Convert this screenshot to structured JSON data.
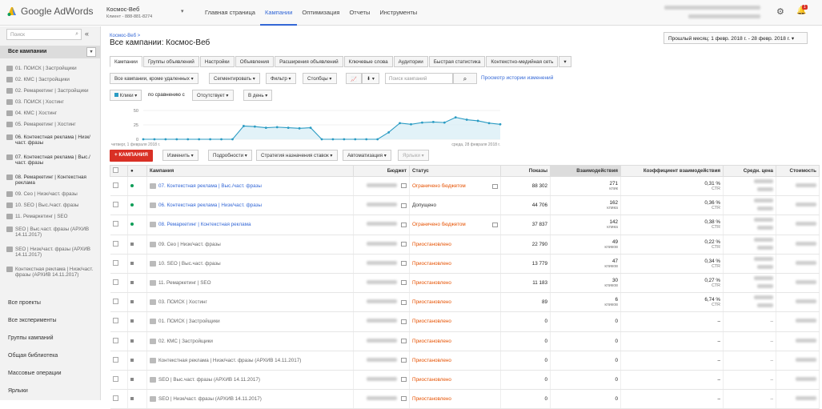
{
  "header": {
    "logo_text": "Google AdWords",
    "account_name": "Космос-Веб",
    "account_sub": "Клиент - 888-881-8274",
    "nav": [
      "Главная страница",
      "Кампании",
      "Оптимизация",
      "Отчеты",
      "Инструменты"
    ],
    "active_nav": "Кампании",
    "bell_count": "1"
  },
  "sidebar": {
    "search_placeholder": "Поиск",
    "all_campaigns": "Все кампании",
    "items": [
      "01. ПОИСК | Застройщики",
      "02. КМС | Застройщики",
      "02. Ремаркетинг | Застройщики",
      "03. ПОИСК | Хостинг",
      "04. КМС | Хостинг",
      "05. Ремаркетинг | Хостинг",
      "06. Контекстная реклама | Низк/част. фразы",
      "07. Контекстная реклама | Выс./част. фразы",
      "08. Ремаркетинг | Контекстная реклама",
      "09. Сео | Низк/част. фразы",
      "10. SEO | Выс./част. фразы",
      "11. Ремаркетинг | SEO",
      "SEO | Выс.част. фразы (АРХИВ 14.11.2017)",
      "SEO | Низк/част. фразы (АРХИВ 14.11.2017)",
      "Контекстная реклама | Низк/част. фразы (АРХИВ 14.11.2017)"
    ],
    "bottom": [
      "Все проекты",
      "Все эксперименты",
      "Группы кампаний",
      "Общая библиотека",
      "Массовые операции",
      "Ярлыки"
    ]
  },
  "page": {
    "breadcrumb": "Космос-Веб >",
    "title": "Все кампании: Космос-Веб",
    "date_range": "Прошлый месяц: 1 февр. 2018 г. - 28 февр. 2018 г."
  },
  "tabs": [
    "Кампании",
    "Группы объявлений",
    "Настройки",
    "Объявления",
    "Расширения объявлений",
    "Ключевые слова",
    "Аудитории",
    "Быстрая статистика",
    "Контекстно-медийная сеть",
    "▾"
  ],
  "toolbar": {
    "filter_all": "Все кампании, кроме удаленных",
    "segment": "Сегментировать",
    "filter": "Фильтр",
    "columns": "Столбцы",
    "search_placeholder": "Поиск кампаний",
    "history_link": "Просмотр истории изменений",
    "metric": "Клики",
    "compare_label": "по сравнению с",
    "compare_value": "Отсутствует",
    "period": "В день",
    "add_campaign": "+ КАМПАНИЯ",
    "edit": "Изменить",
    "details": "Подробности",
    "bid_strategy": "Стратегия назначения ставок",
    "automation": "Автоматизация",
    "labels": "Ярлыки"
  },
  "chart_data": {
    "type": "line",
    "ylim": [
      0,
      50
    ],
    "yticks": [
      0,
      25,
      50
    ],
    "x_start_label": "четверг, 1 февраля 2018 г.",
    "x_end_label": "среда, 28 февраля 2018 г.",
    "values": [
      0,
      0,
      0,
      0,
      0,
      0,
      0,
      0,
      0,
      23,
      22,
      20,
      21,
      20,
      19,
      20,
      0,
      0,
      0,
      0,
      0,
      0,
      12,
      28,
      26,
      29,
      30,
      29,
      38,
      34,
      32,
      28,
      26
    ]
  },
  "table": {
    "headers": [
      "",
      "●",
      "Кампания",
      "Бюджет",
      "Статус",
      "Показы",
      "Взаимодействия",
      "Коэффициент взаимодействия",
      "Средн. цена",
      "Стоимость"
    ],
    "rows": [
      {
        "name": "07. Контекстная реклама | Выс./част. фразы",
        "active": true,
        "status": "Ограничено бюджетом",
        "status_type": "lim",
        "impr": "88 302",
        "inter": "271",
        "inter_sub": "клик",
        "rate": "0,31 %",
        "rate_sub": "CTR"
      },
      {
        "name": "06. Контекстная реклама | Низк/част. фразы",
        "active": true,
        "status": "Допущено",
        "status_type": "ok",
        "impr": "44 706",
        "inter": "162",
        "inter_sub": "клика",
        "rate": "0,36 %",
        "rate_sub": "CTR"
      },
      {
        "name": "08. Ремаркетинг | Контекстная реклама",
        "active": true,
        "status": "Ограничено бюджетом",
        "status_type": "lim",
        "impr": "37 837",
        "inter": "142",
        "inter_sub": "клика",
        "rate": "0,38 %",
        "rate_sub": "CTR"
      },
      {
        "name": "09. Сео | Низк/част. фразы",
        "active": false,
        "status": "Приостановлено",
        "status_type": "pause",
        "impr": "22 790",
        "inter": "49",
        "inter_sub": "кликов",
        "rate": "0,22 %",
        "rate_sub": "CTR"
      },
      {
        "name": "10. SEO | Выс.част. фразы",
        "active": false,
        "status": "Приостановлено",
        "status_type": "pause",
        "impr": "13 779",
        "inter": "47",
        "inter_sub": "кликов",
        "rate": "0,34 %",
        "rate_sub": "CTR"
      },
      {
        "name": "11. Ремаркетинг | SEO",
        "active": false,
        "status": "Приостановлено",
        "status_type": "pause",
        "impr": "11 183",
        "inter": "30",
        "inter_sub": "кликов",
        "rate": "0,27 %",
        "rate_sub": "CTR"
      },
      {
        "name": "03. ПОИСК | Хостинг",
        "active": false,
        "status": "Приостановлено",
        "status_type": "pause",
        "impr": "89",
        "inter": "6",
        "inter_sub": "кликов",
        "rate": "6,74 %",
        "rate_sub": "CTR"
      },
      {
        "name": "01. ПОИСК | Застройщики",
        "active": false,
        "status": "Приостановлено",
        "status_type": "pause",
        "impr": "0",
        "inter": "0",
        "inter_sub": "",
        "rate": "–",
        "rate_sub": ""
      },
      {
        "name": "02. КМС | Застройщики",
        "active": false,
        "status": "Приостановлено",
        "status_type": "pause",
        "impr": "0",
        "inter": "0",
        "inter_sub": "",
        "rate": "–",
        "rate_sub": ""
      },
      {
        "name": "Контекстная реклама | Низк/част. фразы (АРХИВ 14.11.2017)",
        "active": false,
        "status": "Приостановлено",
        "status_type": "pause",
        "impr": "0",
        "inter": "0",
        "inter_sub": "",
        "rate": "–",
        "rate_sub": ""
      },
      {
        "name": "SEO | Выс.част. фразы (АРХИВ 14.11.2017)",
        "active": false,
        "status": "Приостановлено",
        "status_type": "pause",
        "impr": "0",
        "inter": "0",
        "inter_sub": "",
        "rate": "–",
        "rate_sub": ""
      },
      {
        "name": "SEO | Низк/част. фразы (АРХИВ 14.11.2017)",
        "active": false,
        "status": "Приостановлено",
        "status_type": "pause",
        "impr": "0",
        "inter": "0",
        "inter_sub": "",
        "rate": "–",
        "rate_sub": ""
      }
    ]
  },
  "colors": {
    "accent": "#3367d6",
    "red": "#d93025",
    "warning": "#e65100",
    "line": "#2a9bc3"
  }
}
